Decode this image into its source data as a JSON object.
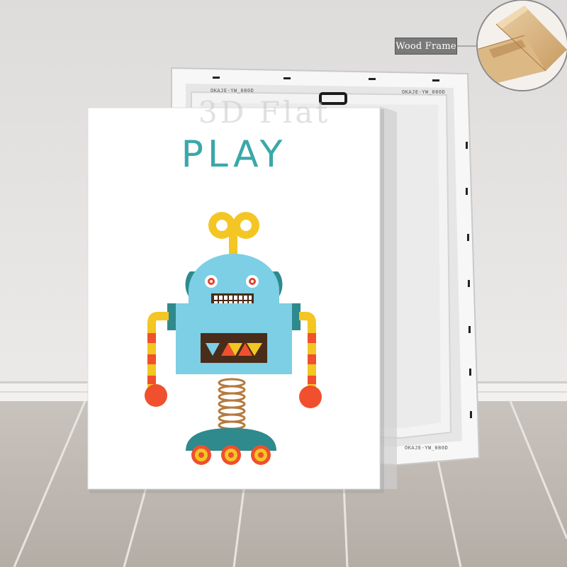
{
  "callout": {
    "label": "Wood Frame"
  },
  "poster": {
    "title": "PLAY"
  },
  "watermark": {
    "text": "3D Flat"
  },
  "stretcher_stamps": {
    "top_left": "OKAJE-YW_080D",
    "top_right": "OKAJE-YW_080D",
    "bottom": "OKAJE-YW_080D"
  },
  "colors": {
    "wall": "#e4e2e1",
    "floor": "#bdb6b0",
    "robot_body": "#7ccfe4",
    "robot_accent": "#2e8a8c",
    "key": "#f3c623",
    "limbs_red": "#f0502e",
    "title_teal": "#3aa8a9"
  }
}
